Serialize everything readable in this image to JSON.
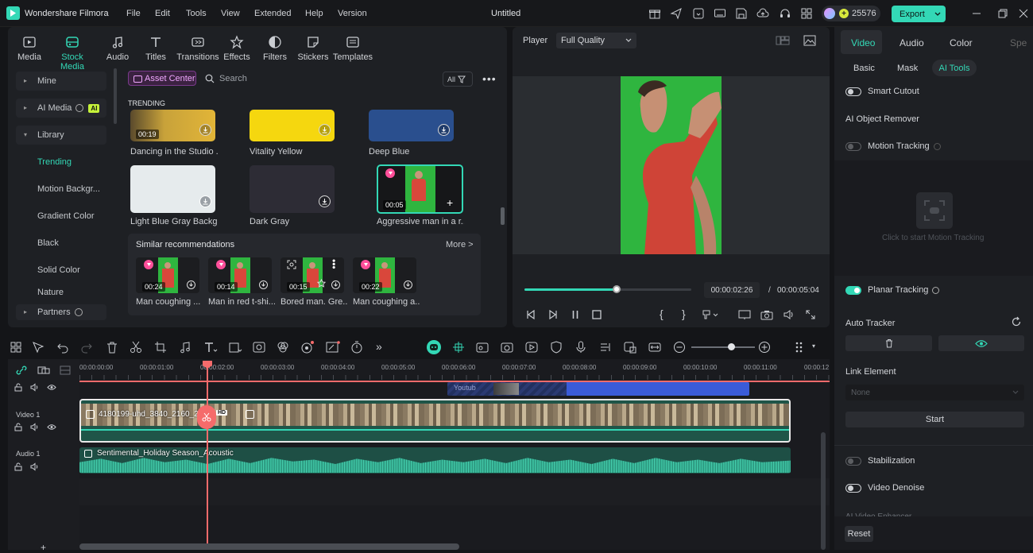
{
  "app": {
    "name": "Wondershare Filmora",
    "doc_title": "Untitled",
    "credits": "25576",
    "export_label": "Export"
  },
  "menu": [
    "File",
    "Edit",
    "Tools",
    "View",
    "Extended",
    "Help",
    "Version"
  ],
  "media_tabs": [
    "Media",
    "Stock Media",
    "Audio",
    "Titles",
    "Transitions",
    "Effects",
    "Filters",
    "Stickers",
    "Templates"
  ],
  "sidebar": {
    "mine": "Mine",
    "ai_media": "AI Media",
    "ai_badge": "AI",
    "library": "Library",
    "items": [
      "Trending",
      "Motion Backgr...",
      "Gradient Color",
      "Black",
      "Solid Color",
      "Nature"
    ],
    "partners": "Partners"
  },
  "browser": {
    "asset_center": "Asset Center",
    "search_placeholder": "Search",
    "filter": "All",
    "section": "TRENDING"
  },
  "assets": [
    {
      "caption": "Dancing in the Studio ...",
      "duration": "00:19"
    },
    {
      "caption": "Vitality Yellow"
    },
    {
      "caption": "Deep Blue"
    },
    {
      "caption": "Light Blue Gray Backgr..."
    },
    {
      "caption": "Dark Gray"
    },
    {
      "caption": "Aggressive man in a r...",
      "duration": "00:05"
    }
  ],
  "similar": {
    "title": "Similar recommendations",
    "more": "More >",
    "items": [
      {
        "caption": "Man coughing ...",
        "duration": "00:24"
      },
      {
        "caption": "Man in red t-shi...",
        "duration": "00:14"
      },
      {
        "caption": "Bored man. Gre...",
        "duration": "00:15"
      },
      {
        "caption": "Man coughing a...",
        "duration": "00:22"
      }
    ]
  },
  "player": {
    "label": "Player",
    "quality": "Full Quality",
    "current_time": "00:00:02:26",
    "separator": "/",
    "total_time": "00:00:05:04",
    "progress": 0.55
  },
  "props": {
    "tabs": [
      "Video",
      "Audio",
      "Color",
      "Spe"
    ],
    "subtabs": [
      "Basic",
      "Mask",
      "AI Tools"
    ],
    "smart_cutout": "Smart Cutout",
    "ai_object_remover": "AI Object Remover",
    "motion_tracking": "Motion Tracking",
    "motion_hint": "Click to start Motion Tracking",
    "planar_tracking": "Planar Tracking",
    "auto_tracker": "Auto Tracker",
    "link_element": "Link Element",
    "link_value": "None",
    "start": "Start",
    "stabilization": "Stabilization",
    "video_denoise": "Video Denoise",
    "ai_video_enhancer": "AI Video Enhancer",
    "reset": "Reset"
  },
  "timeline": {
    "ruler": [
      "00:00:00:00",
      "00:00:01:00",
      "00:00:02:00",
      "00:00:03:00",
      "00:00:04:00",
      "00:00:05:00",
      "00:00:06:00",
      "00:00:07:00",
      "00:00:08:00",
      "00:00:09:00",
      "00:00:10:00",
      "00:00:11:00",
      "00:00:12"
    ],
    "video_track": "Video 1",
    "audio_track": "Audio 1",
    "video_clip": "4180199-uhd_3840_2160_2",
    "hd_badge": "HD",
    "audio_clip": "Sentimental_Holiday Season_Acoustic",
    "overlay_clip": "Youtub"
  },
  "colors": {
    "accent": "#33d8b6",
    "playhead": "#f56b6b",
    "green_screen": "#2fb53f",
    "overlay": "#3a5bd9"
  }
}
